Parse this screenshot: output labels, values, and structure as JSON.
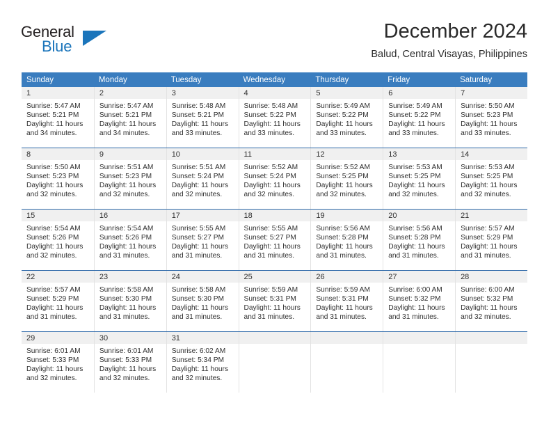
{
  "brand": {
    "name_part1": "General",
    "name_part2": "Blue",
    "logo_colors": {
      "dark": "#231f20",
      "blue": "#1b75bb"
    }
  },
  "header": {
    "title": "December 2024",
    "subtitle": "Balud, Central Visayas, Philippines"
  },
  "theme": {
    "header_row_bg": "#3a7dbf",
    "row_divider": "#2c68a8",
    "daynum_band_bg": "#f0f0f0",
    "text": "#2f2f2f"
  },
  "weekday_headers": [
    "Sunday",
    "Monday",
    "Tuesday",
    "Wednesday",
    "Thursday",
    "Friday",
    "Saturday"
  ],
  "weeks": [
    [
      {
        "day": "1",
        "sunrise": "Sunrise: 5:47 AM",
        "sunset": "Sunset: 5:21 PM",
        "daylight_line1": "Daylight: 11 hours",
        "daylight_line2": "and 34 minutes."
      },
      {
        "day": "2",
        "sunrise": "Sunrise: 5:47 AM",
        "sunset": "Sunset: 5:21 PM",
        "daylight_line1": "Daylight: 11 hours",
        "daylight_line2": "and 34 minutes."
      },
      {
        "day": "3",
        "sunrise": "Sunrise: 5:48 AM",
        "sunset": "Sunset: 5:21 PM",
        "daylight_line1": "Daylight: 11 hours",
        "daylight_line2": "and 33 minutes."
      },
      {
        "day": "4",
        "sunrise": "Sunrise: 5:48 AM",
        "sunset": "Sunset: 5:22 PM",
        "daylight_line1": "Daylight: 11 hours",
        "daylight_line2": "and 33 minutes."
      },
      {
        "day": "5",
        "sunrise": "Sunrise: 5:49 AM",
        "sunset": "Sunset: 5:22 PM",
        "daylight_line1": "Daylight: 11 hours",
        "daylight_line2": "and 33 minutes."
      },
      {
        "day": "6",
        "sunrise": "Sunrise: 5:49 AM",
        "sunset": "Sunset: 5:22 PM",
        "daylight_line1": "Daylight: 11 hours",
        "daylight_line2": "and 33 minutes."
      },
      {
        "day": "7",
        "sunrise": "Sunrise: 5:50 AM",
        "sunset": "Sunset: 5:23 PM",
        "daylight_line1": "Daylight: 11 hours",
        "daylight_line2": "and 33 minutes."
      }
    ],
    [
      {
        "day": "8",
        "sunrise": "Sunrise: 5:50 AM",
        "sunset": "Sunset: 5:23 PM",
        "daylight_line1": "Daylight: 11 hours",
        "daylight_line2": "and 32 minutes."
      },
      {
        "day": "9",
        "sunrise": "Sunrise: 5:51 AM",
        "sunset": "Sunset: 5:23 PM",
        "daylight_line1": "Daylight: 11 hours",
        "daylight_line2": "and 32 minutes."
      },
      {
        "day": "10",
        "sunrise": "Sunrise: 5:51 AM",
        "sunset": "Sunset: 5:24 PM",
        "daylight_line1": "Daylight: 11 hours",
        "daylight_line2": "and 32 minutes."
      },
      {
        "day": "11",
        "sunrise": "Sunrise: 5:52 AM",
        "sunset": "Sunset: 5:24 PM",
        "daylight_line1": "Daylight: 11 hours",
        "daylight_line2": "and 32 minutes."
      },
      {
        "day": "12",
        "sunrise": "Sunrise: 5:52 AM",
        "sunset": "Sunset: 5:25 PM",
        "daylight_line1": "Daylight: 11 hours",
        "daylight_line2": "and 32 minutes."
      },
      {
        "day": "13",
        "sunrise": "Sunrise: 5:53 AM",
        "sunset": "Sunset: 5:25 PM",
        "daylight_line1": "Daylight: 11 hours",
        "daylight_line2": "and 32 minutes."
      },
      {
        "day": "14",
        "sunrise": "Sunrise: 5:53 AM",
        "sunset": "Sunset: 5:25 PM",
        "daylight_line1": "Daylight: 11 hours",
        "daylight_line2": "and 32 minutes."
      }
    ],
    [
      {
        "day": "15",
        "sunrise": "Sunrise: 5:54 AM",
        "sunset": "Sunset: 5:26 PM",
        "daylight_line1": "Daylight: 11 hours",
        "daylight_line2": "and 32 minutes."
      },
      {
        "day": "16",
        "sunrise": "Sunrise: 5:54 AM",
        "sunset": "Sunset: 5:26 PM",
        "daylight_line1": "Daylight: 11 hours",
        "daylight_line2": "and 31 minutes."
      },
      {
        "day": "17",
        "sunrise": "Sunrise: 5:55 AM",
        "sunset": "Sunset: 5:27 PM",
        "daylight_line1": "Daylight: 11 hours",
        "daylight_line2": "and 31 minutes."
      },
      {
        "day": "18",
        "sunrise": "Sunrise: 5:55 AM",
        "sunset": "Sunset: 5:27 PM",
        "daylight_line1": "Daylight: 11 hours",
        "daylight_line2": "and 31 minutes."
      },
      {
        "day": "19",
        "sunrise": "Sunrise: 5:56 AM",
        "sunset": "Sunset: 5:28 PM",
        "daylight_line1": "Daylight: 11 hours",
        "daylight_line2": "and 31 minutes."
      },
      {
        "day": "20",
        "sunrise": "Sunrise: 5:56 AM",
        "sunset": "Sunset: 5:28 PM",
        "daylight_line1": "Daylight: 11 hours",
        "daylight_line2": "and 31 minutes."
      },
      {
        "day": "21",
        "sunrise": "Sunrise: 5:57 AM",
        "sunset": "Sunset: 5:29 PM",
        "daylight_line1": "Daylight: 11 hours",
        "daylight_line2": "and 31 minutes."
      }
    ],
    [
      {
        "day": "22",
        "sunrise": "Sunrise: 5:57 AM",
        "sunset": "Sunset: 5:29 PM",
        "daylight_line1": "Daylight: 11 hours",
        "daylight_line2": "and 31 minutes."
      },
      {
        "day": "23",
        "sunrise": "Sunrise: 5:58 AM",
        "sunset": "Sunset: 5:30 PM",
        "daylight_line1": "Daylight: 11 hours",
        "daylight_line2": "and 31 minutes."
      },
      {
        "day": "24",
        "sunrise": "Sunrise: 5:58 AM",
        "sunset": "Sunset: 5:30 PM",
        "daylight_line1": "Daylight: 11 hours",
        "daylight_line2": "and 31 minutes."
      },
      {
        "day": "25",
        "sunrise": "Sunrise: 5:59 AM",
        "sunset": "Sunset: 5:31 PM",
        "daylight_line1": "Daylight: 11 hours",
        "daylight_line2": "and 31 minutes."
      },
      {
        "day": "26",
        "sunrise": "Sunrise: 5:59 AM",
        "sunset": "Sunset: 5:31 PM",
        "daylight_line1": "Daylight: 11 hours",
        "daylight_line2": "and 31 minutes."
      },
      {
        "day": "27",
        "sunrise": "Sunrise: 6:00 AM",
        "sunset": "Sunset: 5:32 PM",
        "daylight_line1": "Daylight: 11 hours",
        "daylight_line2": "and 31 minutes."
      },
      {
        "day": "28",
        "sunrise": "Sunrise: 6:00 AM",
        "sunset": "Sunset: 5:32 PM",
        "daylight_line1": "Daylight: 11 hours",
        "daylight_line2": "and 32 minutes."
      }
    ],
    [
      {
        "day": "29",
        "sunrise": "Sunrise: 6:01 AM",
        "sunset": "Sunset: 5:33 PM",
        "daylight_line1": "Daylight: 11 hours",
        "daylight_line2": "and 32 minutes."
      },
      {
        "day": "30",
        "sunrise": "Sunrise: 6:01 AM",
        "sunset": "Sunset: 5:33 PM",
        "daylight_line1": "Daylight: 11 hours",
        "daylight_line2": "and 32 minutes."
      },
      {
        "day": "31",
        "sunrise": "Sunrise: 6:02 AM",
        "sunset": "Sunset: 5:34 PM",
        "daylight_line1": "Daylight: 11 hours",
        "daylight_line2": "and 32 minutes."
      },
      {
        "day": "",
        "sunrise": "",
        "sunset": "",
        "daylight_line1": "",
        "daylight_line2": ""
      },
      {
        "day": "",
        "sunrise": "",
        "sunset": "",
        "daylight_line1": "",
        "daylight_line2": ""
      },
      {
        "day": "",
        "sunrise": "",
        "sunset": "",
        "daylight_line1": "",
        "daylight_line2": ""
      },
      {
        "day": "",
        "sunrise": "",
        "sunset": "",
        "daylight_line1": "",
        "daylight_line2": ""
      }
    ]
  ]
}
